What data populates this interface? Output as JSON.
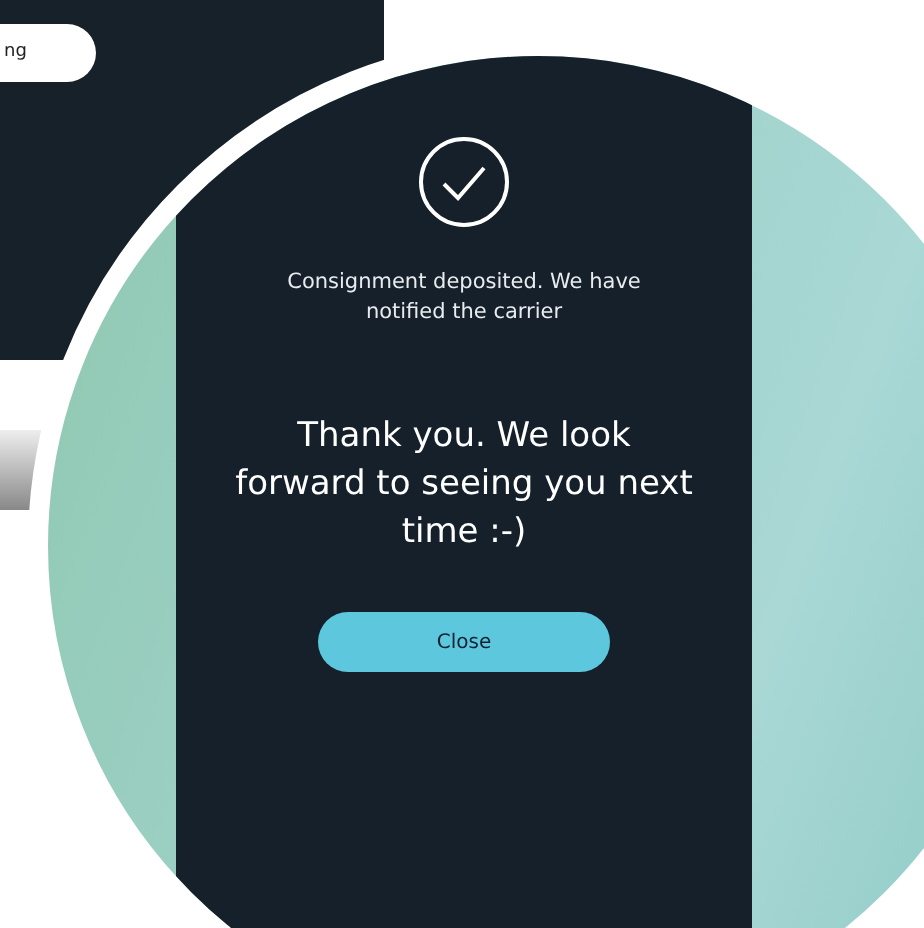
{
  "background_screen": {
    "button_label": "ng"
  },
  "lens_screen": {
    "message": "Consignment deposited. We have notified the carrier",
    "thanks": "Thank you. We look forward to seeing you next time :-)",
    "close_button": "Close"
  }
}
